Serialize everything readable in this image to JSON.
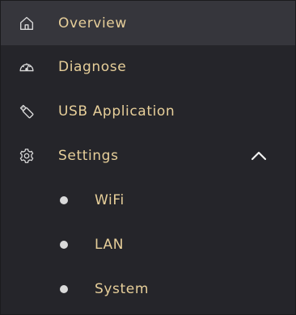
{
  "theme": {
    "background": "#25252a",
    "active_background": "#36363c",
    "label_color": "#e7cf9a",
    "icon_color": "#d9d9d9"
  },
  "menu": {
    "overview": {
      "label": "Overview",
      "icon": "home-icon",
      "active": true
    },
    "diagnose": {
      "label": "Diagnose",
      "icon": "speedometer-icon"
    },
    "usb": {
      "label": "USB Application",
      "icon": "usb-icon"
    },
    "settings": {
      "label": "Settings",
      "icon": "gear-icon",
      "expanded": true,
      "toggle_icon": "chevron-up-icon",
      "children": [
        {
          "label": "WiFi"
        },
        {
          "label": "LAN"
        },
        {
          "label": "System"
        }
      ]
    }
  }
}
